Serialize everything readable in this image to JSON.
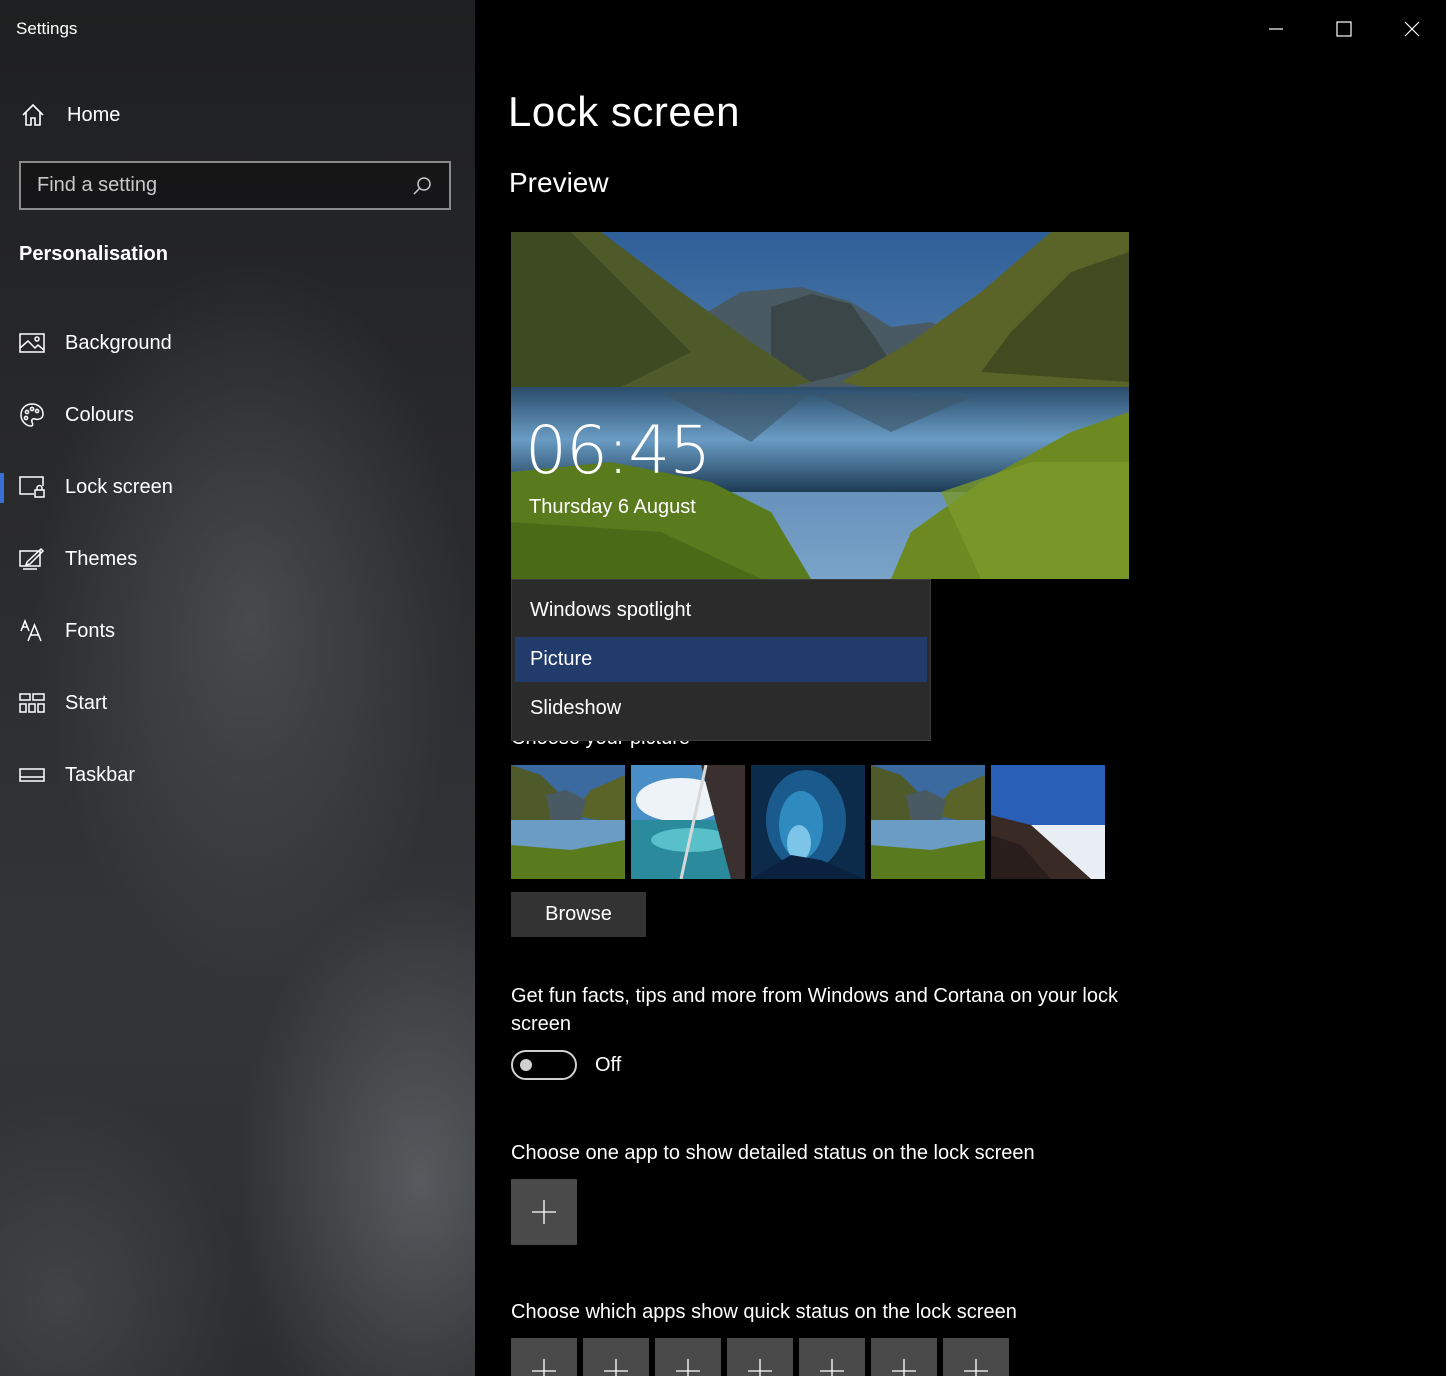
{
  "window": {
    "title": "Settings",
    "controls": {
      "minimize": "minimize-icon",
      "maximize": "maximize-icon",
      "close": "close-icon"
    }
  },
  "sidebar": {
    "home_label": "Home",
    "search": {
      "placeholder": "Find a setting",
      "value": ""
    },
    "section": "Personalisation",
    "items": [
      {
        "label": "Background",
        "icon": "picture-icon"
      },
      {
        "label": "Colours",
        "icon": "palette-icon"
      },
      {
        "label": "Lock screen",
        "icon": "lock-screen-icon",
        "active": true
      },
      {
        "label": "Themes",
        "icon": "themes-icon"
      },
      {
        "label": "Fonts",
        "icon": "fonts-icon"
      },
      {
        "label": "Start",
        "icon": "start-icon"
      },
      {
        "label": "Taskbar",
        "icon": "taskbar-icon"
      }
    ],
    "accent_color": "#3a6fd6"
  },
  "main": {
    "title": "Lock screen",
    "preview_heading": "Preview",
    "preview": {
      "time": "06:45",
      "date": "Thursday 6 August"
    },
    "background_dropdown": {
      "options": [
        "Windows spotlight",
        "Picture",
        "Slideshow"
      ],
      "selected": "Picture",
      "selected_color": "#213b6b"
    },
    "choose_picture_label": "Choose your picture",
    "thumbnails": [
      "lake-mountains",
      "aerial-ocean-airplane-wing",
      "ice-cave",
      "lake-mountains",
      "mountain-ridge-clouds"
    ],
    "browse_label": "Browse",
    "tips": {
      "text": "Get fun facts, tips and more from Windows and Cortana on your lock screen",
      "state": "Off"
    },
    "detailed_status_label": "Choose one app to show detailed status on the lock screen",
    "quick_status_label": "Choose which apps show quick status on the lock screen"
  }
}
